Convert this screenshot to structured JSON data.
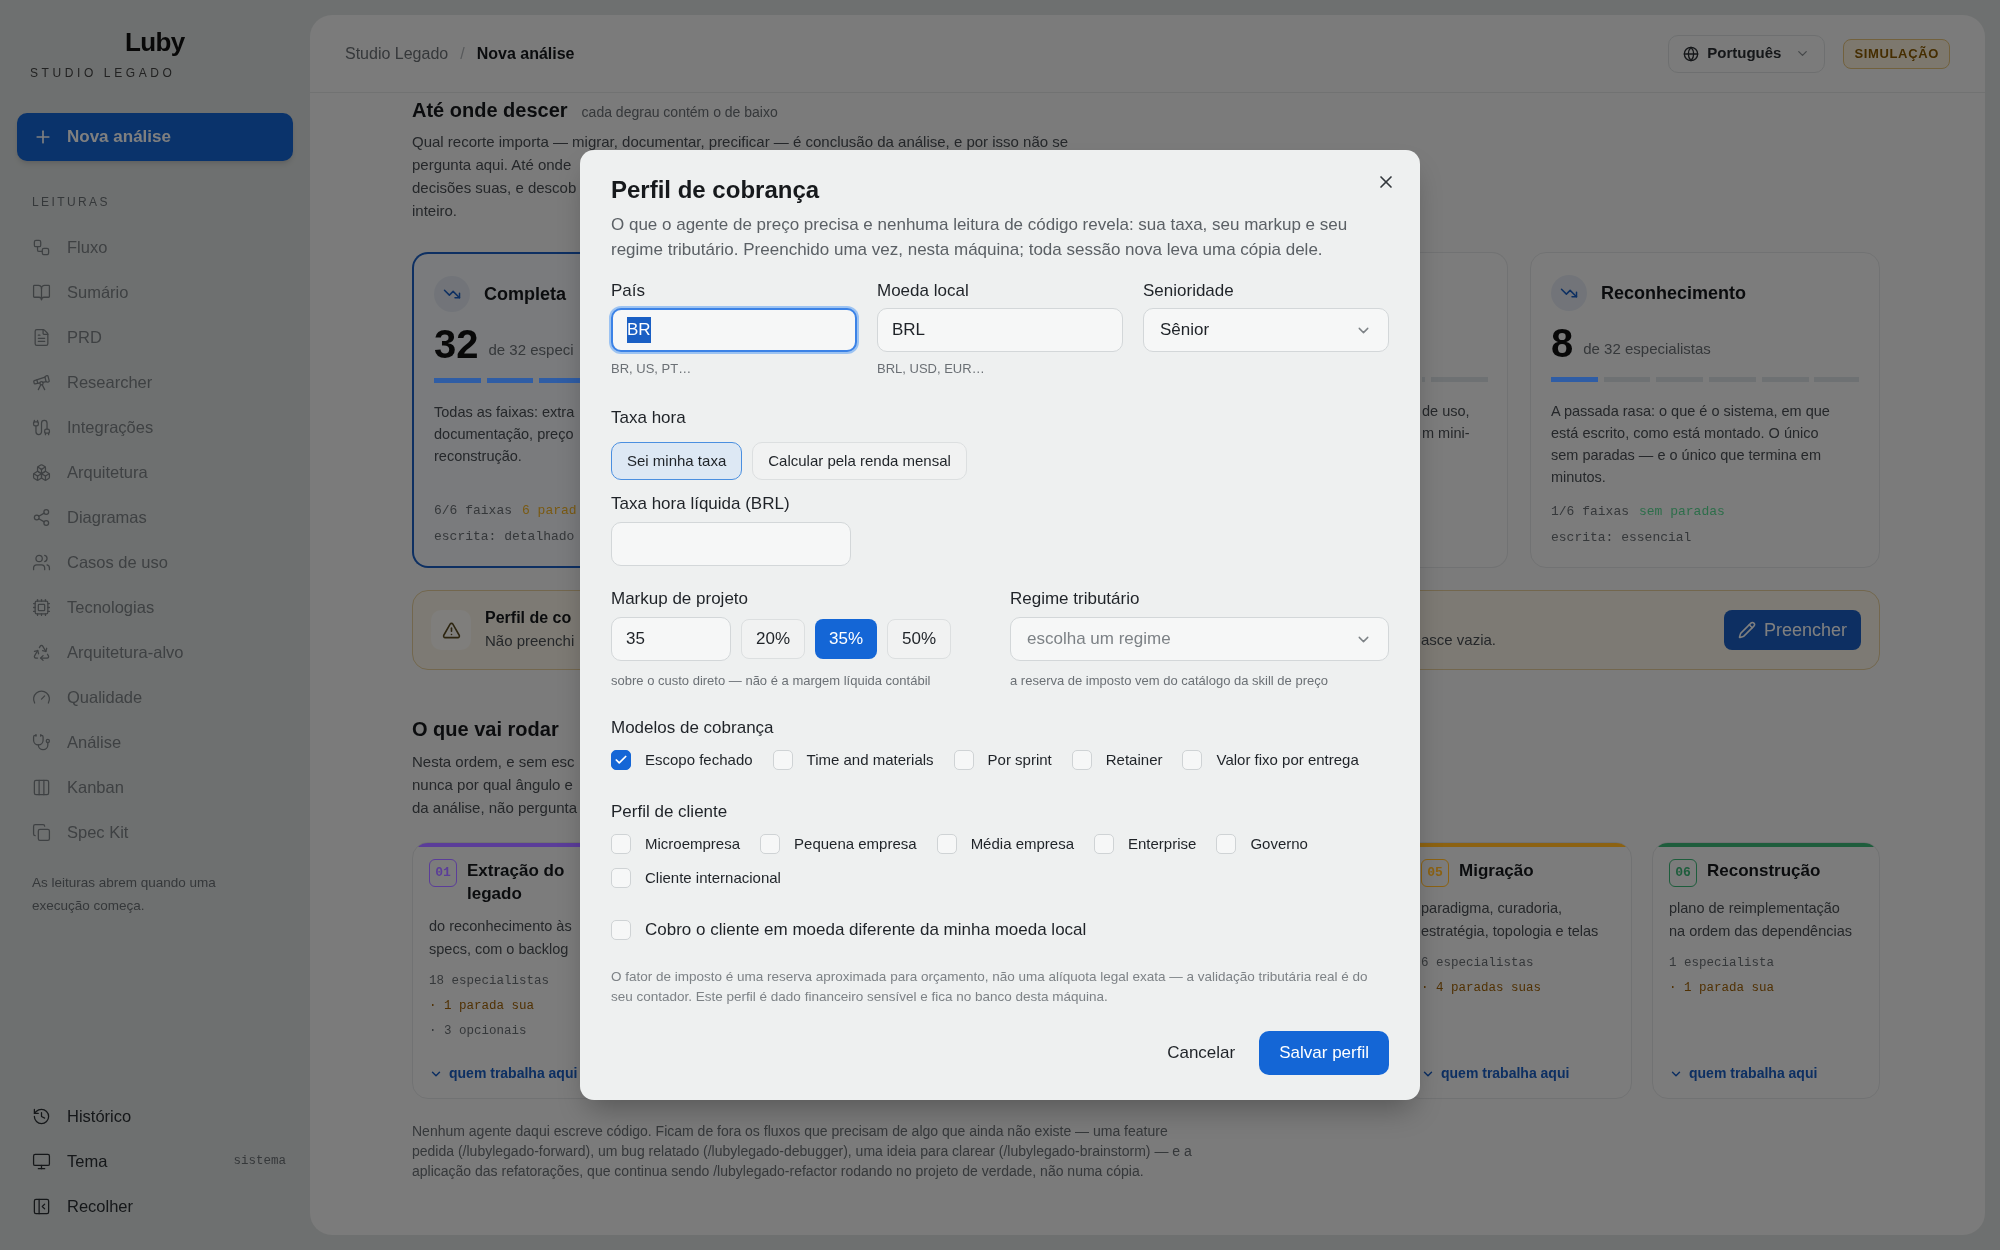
{
  "sidebar": {
    "logo": "Luby",
    "subtitle": "STUDIO LEGADO",
    "new_button": "Nova análise",
    "section": "LEITURAS",
    "items": [
      {
        "label": "Fluxo",
        "disabled": true
      },
      {
        "label": "Sumário",
        "disabled": true
      },
      {
        "label": "PRD",
        "disabled": true
      },
      {
        "label": "Researcher",
        "disabled": true
      },
      {
        "label": "Integrações",
        "disabled": true
      },
      {
        "label": "Arquitetura",
        "disabled": true
      },
      {
        "label": "Diagramas",
        "disabled": true
      },
      {
        "label": "Casos de uso",
        "disabled": true
      },
      {
        "label": "Tecnologias",
        "disabled": true
      },
      {
        "label": "Arquitetura-alvo",
        "disabled": true
      },
      {
        "label": "Qualidade",
        "disabled": true
      },
      {
        "label": "Análise",
        "disabled": true
      },
      {
        "label": "Kanban",
        "disabled": true
      },
      {
        "label": "Spec Kit",
        "disabled": true
      }
    ],
    "note": "As leituras abrem quando uma execução começa.",
    "footer_items": [
      {
        "kind": "history",
        "label": "Histórico"
      },
      {
        "kind": "theme",
        "label": "Tema",
        "value": "sistema"
      },
      {
        "kind": "collapse",
        "label": "Recolher"
      }
    ]
  },
  "header": {
    "breadcrumb": [
      "Studio Legado",
      "Nova análise"
    ],
    "separator": "/",
    "language": "Português",
    "badge": "SIMULAÇÃO"
  },
  "depth": {
    "title": "Até onde descer",
    "subtitle": "cada degrau contém o de baixo",
    "paragraph_lines": [
      "Qual recorte importa — migrar, documentar, precificar — é conclusão da análise, e por isso não se",
      "pergunta aqui. Até onde",
      "decisões suas, e descob",
      "inteiro."
    ],
    "cards": [
      {
        "title": "Completa",
        "count": "32",
        "count_label": "de 32 especi",
        "level": 1,
        "selected": true,
        "description_lines": [
          "Todas as faixas: extra",
          "documentação, preço",
          "reconstrução."
        ],
        "lanes": "6/6 faixas",
        "stops": {
          "text": "6 parad",
          "color": "#7a5a12"
        },
        "writing": "escrita: detalhado"
      },
      {
        "selected": false,
        "description_lines": [
          "de uso,",
          "m mini-"
        ]
      },
      {
        "title": "Reconhecimento",
        "count": "8",
        "count_label": "de 32 especialistas",
        "level": 0.1667,
        "selected": false,
        "description_lines": [
          "A passada rasa: o que é o sistema, em que",
          "está escrito, como está montado. O único",
          "sem paradas — e o único que termina em",
          "minutos."
        ],
        "lanes": "1/6 faixas",
        "stops": {
          "text": "sem paradas",
          "color": "#2d6e4a"
        },
        "writing": "escrita: essencial"
      }
    ]
  },
  "banner": {
    "title": "Perfil de co",
    "description": "Não preenchi",
    "tail": "asce vazia.",
    "button": "Preencher"
  },
  "run": {
    "title": "O que vai rodar",
    "paragraph_lines": [
      "Nesta ordem, e sem esc",
      "nunca por qual ângulo e",
      "da análise, não pergunta"
    ],
    "stages": [
      {
        "number": "01",
        "title": "Extração do legado",
        "color": "#5b3d99",
        "description_lines": [
          "do reconhecimento às",
          "specs, com o backlog"
        ],
        "lines": [
          {
            "kind": "count",
            "text": "18 especialistas"
          },
          {
            "kind": "stops",
            "text": "· 1 parada sua"
          },
          {
            "kind": "optional",
            "text": "· 3 opcionais"
          }
        ],
        "link": "quem trabalha aqui"
      },
      {
        "number": "05",
        "title": "Migração",
        "color": "#8c6212",
        "description_lines": [
          "paradigma, curadoria,",
          "estratégia, topologia e telas"
        ],
        "lines": [
          {
            "kind": "count",
            "text": "6 especialistas"
          },
          {
            "kind": "stops",
            "text": "· 4 paradas suas"
          }
        ],
        "link": "quem trabalha aqui"
      },
      {
        "number": "06",
        "title": "Reconstrução",
        "color": "#1e5d3c",
        "description_lines": [
          "plano de reimplementação",
          "na ordem das dependências"
        ],
        "lines": [
          {
            "kind": "count",
            "text": "1 especialista"
          },
          {
            "kind": "stops",
            "text": "· 1 parada sua"
          }
        ],
        "link": "quem trabalha aqui"
      }
    ],
    "footer": "Nenhum agente daqui escreve código. Ficam de fora os fluxos que precisam de algo que ainda não existe — uma feature pedida (/lubylegado-forward), um bug relatado (/lubylegado-debugger), uma ideia para clarear (/lubylegado-brainstorm) — e a aplicação das refatorações, que continua sendo /lubylegado-refactor rodando no projeto de verdade, não numa cópia."
  },
  "modal": {
    "title": "Perfil de cobrança",
    "description": "O que o agente de preço precisa e nenhuma leitura de código revela: sua taxa, seu markup e seu regime tributário. Preenchido uma vez, nesta máquina; toda sessão nova leva uma cópia dele.",
    "fields": [
      {
        "kind": "input",
        "label": "País",
        "value": "BR",
        "focused": true,
        "hint": "BR, US, PT…"
      },
      {
        "kind": "input",
        "label": "Moeda local",
        "value": "BRL",
        "focused": false,
        "hint": "BRL, USD, EUR…"
      },
      {
        "kind": "select",
        "label": "Senioridade",
        "value": "Sênior"
      }
    ],
    "rate": {
      "label": "Taxa hora",
      "options": [
        {
          "label": "Sei minha taxa",
          "selected": true
        },
        {
          "label": "Calcular pela renda mensal",
          "selected": false
        }
      ]
    },
    "net_rate": {
      "label": "Taxa hora líquida (BRL)"
    },
    "markup": {
      "label": "Markup de projeto",
      "value": "35",
      "presets": [
        {
          "label": "20%",
          "selected": false
        },
        {
          "label": "35%",
          "selected": true
        },
        {
          "label": "50%",
          "selected": false
        }
      ],
      "hint": "sobre o custo direto — não é a margem líquida contábil"
    },
    "tax": {
      "label": "Regime tributário",
      "placeholder": "escolha um regime",
      "hint": "a reserva de imposto vem do catálogo da skill de preço"
    },
    "billing_models": {
      "label": "Modelos de cobrança",
      "options": [
        {
          "label": "Escopo fechado",
          "checked": true
        },
        {
          "label": "Time and materials",
          "checked": false
        },
        {
          "label": "Por sprint",
          "checked": false
        },
        {
          "label": "Retainer",
          "checked": false
        },
        {
          "label": "Valor fixo por entrega",
          "checked": false
        }
      ]
    },
    "client_profile": {
      "label": "Perfil de cliente",
      "options": [
        {
          "label": "Microempresa",
          "checked": false
        },
        {
          "label": "Pequena empresa",
          "checked": false
        },
        {
          "label": "Média empresa",
          "checked": false
        },
        {
          "label": "Enterprise",
          "checked": false
        },
        {
          "label": "Governo",
          "checked": false
        },
        {
          "label": "Cliente internacional",
          "checked": false
        }
      ]
    },
    "foreign_currency": {
      "label": "Cobro o cliente em moeda diferente da minha moeda local",
      "checked": false
    },
    "note": "O fator de imposto é uma reserva aproximada para orçamento, não uma alíquota legal exata — a validação tributária real é do seu contador. Este perfil é dado financeiro sensível e fica no banco desta máquina.",
    "buttons": {
      "cancel": "Cancelar",
      "save": "Salvar perfil"
    }
  }
}
